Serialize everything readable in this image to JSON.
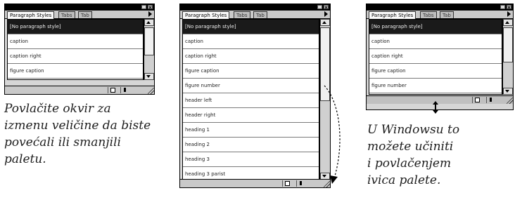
{
  "palettes": {
    "left": {
      "tabs": [
        "Paragraph Styles",
        "Tabs",
        "Tab"
      ],
      "items": [
        "[No paragraph style]",
        "caption",
        "caption right",
        "figure caption"
      ]
    },
    "middle": {
      "tabs": [
        "Paragraph Styles",
        "Tabs",
        "Tab"
      ],
      "items": [
        "[No paragraph style]",
        "caption",
        "caption right",
        "figure caption",
        "figure number",
        "header left",
        "header right",
        "heading 1",
        "heading 2",
        "heading 3",
        "heading 3 parist"
      ]
    },
    "right": {
      "tabs": [
        "Paragraph Styles",
        "Tabs",
        "Tab"
      ],
      "items": [
        "[No paragraph style]",
        "caption",
        "caption right",
        "figure caption",
        "figure number"
      ]
    }
  },
  "captions": {
    "left": [
      "Povlačite okvir za",
      "izmenu veličine da biste",
      "povećali ili smanjili",
      "paletu."
    ],
    "right": [
      "U Windowsu to",
      "možete učiniti",
      "i povlačenjem",
      "ivica palete."
    ]
  },
  "icons": {
    "close": "close-icon",
    "minimize": "minimize-icon",
    "menu_arrow": "palette-menu-arrow-icon",
    "new_style": "new-style-icon",
    "delete_style": "trash-icon",
    "resize_grip": "resize-grip-icon",
    "drag_arrow": "curved-drag-arrow",
    "vertical_resize": "vertical-resize-arrows-icon"
  },
  "colors": {
    "titlebar": "#000000",
    "panel": "#d6d6d6",
    "selected_row": "#1a1a1a",
    "list_bg": "#ffffff"
  }
}
